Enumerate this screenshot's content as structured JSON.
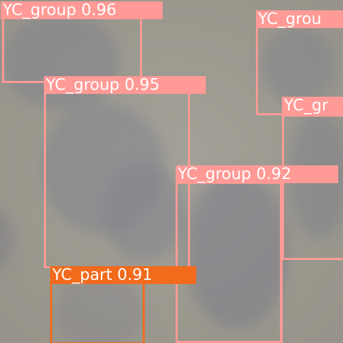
{
  "image": {
    "background": "blurred microscope view of spherical colonies",
    "colors": {
      "YC_group": "#ff9a96",
      "YC_part": "#f26a1b"
    }
  },
  "detections": [
    {
      "class": "YC_group",
      "score": "0.96",
      "text": "YC_group 0.96"
    },
    {
      "class": "YC_group",
      "score": "0.95",
      "text": "YC_group 0.95"
    },
    {
      "class": "YC_group",
      "score": "0.92",
      "text": "YC_group 0.92"
    },
    {
      "class": "YC_part",
      "score": "0.91",
      "text": "YC_part 0.91"
    },
    {
      "class": "YC_group",
      "score": "",
      "text": "YC_grou"
    },
    {
      "class": "YC_group",
      "score": "",
      "text": "YC_gr"
    }
  ]
}
